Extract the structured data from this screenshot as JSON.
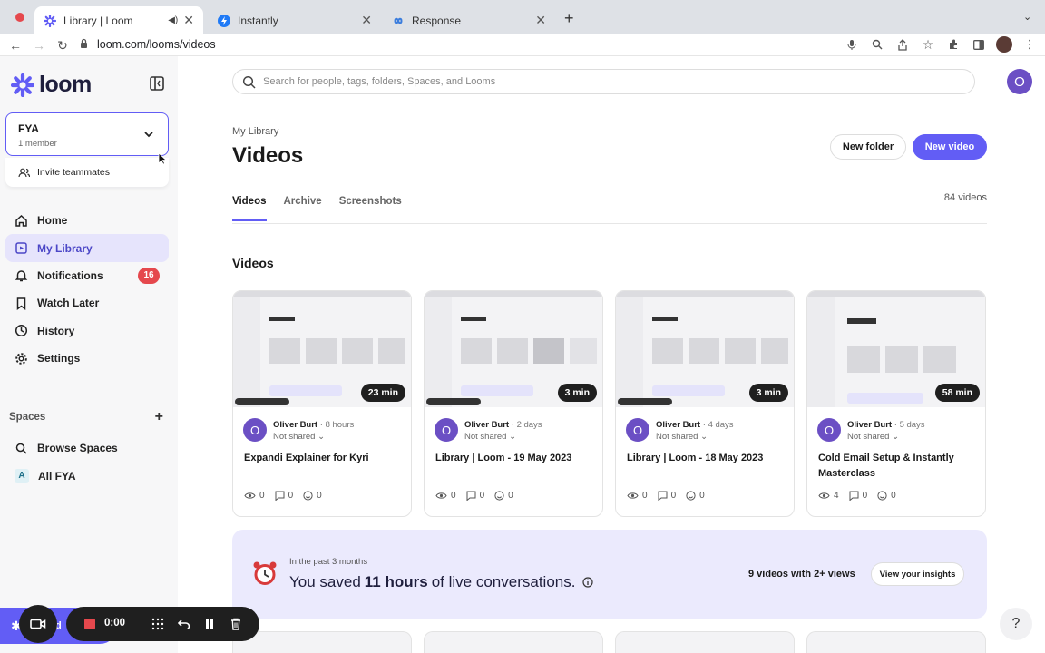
{
  "browser": {
    "tabs": [
      {
        "title": "Library | Loom"
      },
      {
        "title": "Instantly"
      },
      {
        "title": "Response"
      }
    ],
    "url": "loom.com/looms/videos"
  },
  "sidebar": {
    "brand": "loom",
    "workspace": {
      "name": "FYA",
      "members": "1 member",
      "invite": "Invite teammates"
    },
    "nav": [
      {
        "label": "Home"
      },
      {
        "label": "My Library"
      },
      {
        "label": "Notifications",
        "badge": "16"
      },
      {
        "label": "Watch Later"
      },
      {
        "label": "History"
      },
      {
        "label": "Settings"
      }
    ],
    "spaces_heading": "Spaces",
    "spaces": [
      {
        "label": "Browse Spaces"
      },
      {
        "label": "All FYA",
        "prefix": "A"
      }
    ]
  },
  "main": {
    "search_placeholder": "Search for people, tags, folders, Spaces, and Looms",
    "avatar_initial": "O",
    "breadcrumb": "My Library",
    "title": "Videos",
    "new_folder": "New folder",
    "new_video": "New video",
    "tabs": [
      "Videos",
      "Archive",
      "Screenshots"
    ],
    "count": "84 videos",
    "section": "Videos",
    "cards": [
      {
        "duration": "23 min",
        "owner": "Oliver Burt",
        "age": "8 hours",
        "share": "Not shared",
        "title": "Expandi Explainer for Kyri",
        "views": "0",
        "comments": "0",
        "reactions": "0"
      },
      {
        "duration": "3 min",
        "owner": "Oliver Burt",
        "age": "2 days",
        "share": "Not shared",
        "title": "Library | Loom - 19 May 2023",
        "views": "0",
        "comments": "0",
        "reactions": "0"
      },
      {
        "duration": "3 min",
        "owner": "Oliver Burt",
        "age": "4 days",
        "share": "Not shared",
        "title": "Library | Loom - 18 May 2023",
        "views": "0",
        "comments": "0",
        "reactions": "0"
      },
      {
        "duration": "58 min",
        "owner": "Oliver Burt",
        "age": "5 days",
        "share": "Not shared",
        "title": "Cold Email Setup & Instantly Masterclass",
        "views": "4",
        "comments": "0",
        "reactions": "0"
      }
    ],
    "banner": {
      "subtitle": "In the past 3 months",
      "lead": "You saved",
      "highlight": "11 hours",
      "tail": "of live conversations.",
      "views": "9 videos with 2+ views",
      "insights": "View your insights"
    }
  },
  "recorder": {
    "label": "ord",
    "time": "0:00"
  },
  "help": "?",
  "colors": {
    "accent": "#625df5",
    "badge": "#e5484d",
    "avatar": "#6b4fc4",
    "banner": "#ebeafd"
  }
}
